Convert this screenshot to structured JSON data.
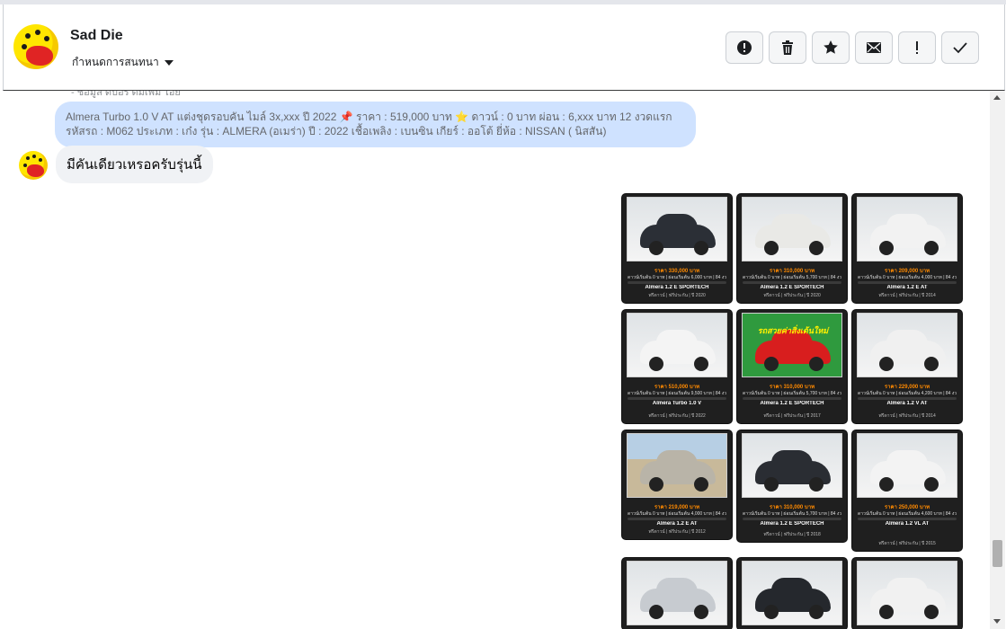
{
  "header": {
    "contact_name": "Sad Die",
    "conversation_menu_label": "กำหนดการสนทนา",
    "actions": [
      {
        "name": "report-button",
        "icon": "exclamation-circle-icon"
      },
      {
        "name": "delete-button",
        "icon": "trash-icon"
      },
      {
        "name": "star-button",
        "icon": "star-icon"
      },
      {
        "name": "mark-unread-button",
        "icon": "envelope-icon"
      },
      {
        "name": "important-button",
        "icon": "exclamation-icon"
      },
      {
        "name": "done-button",
        "icon": "checkmark-icon"
      }
    ]
  },
  "messages": {
    "cut_off_text": "- ชิ้อมูล ดีบอร์ ดิ้มเพิ่ม ไอ้ย",
    "outgoing_text": "Almera Turbo 1.0 V AT แต่งชุดรอบคัน ไมล์ 3x,xxx ปี 2022 📌 ราคา : 519,000 บาท ⭐ ดาวน์ : 0 บาท ผ่อน : 6,xxx บาท 12 งวดแรก รหัสรถ : M062 ประเภท : เก๋ง รุ่น : ALMERA (อเมร่า) ปี : 2022 เชื้อเพลิง : เบนซิน เกียร์ : ออโต้ ยี่ห้อ : NISSAN ( นิสสัน)",
    "incoming_text": "มีคันเดียวเหรอครับรุ่นนี้"
  },
  "cards": [
    {
      "price": "ราคา 330,000 บาท",
      "line": "ดาวน์เริ่มต้น 0 บาท | ผ่อนเริ่มต้น 6,000 บาท | 84 งวด",
      "model": "Almera 1.2 E SPORTECH",
      "meta": "ฟรีดาวน์ | ฟรีประกัน | ปี 2020",
      "photo": "gray",
      "car_color": "#2b2f36"
    },
    {
      "price": "ราคา 310,000 บาท",
      "line": "ดาวน์เริ่มต้น 0 บาท | ผ่อนเริ่มต้น 5,700 บาท | 84 งวด",
      "model": "Almera 1.2 E SPORTECH",
      "meta": "ฟรีดาวน์ | ฟรีประกัน | ปี 2020",
      "photo": "gray",
      "car_color": "#e9e9e6"
    },
    {
      "price": "ราคา 209,000 บาท",
      "line": "ดาวน์เริ่มต้น 0 บาท | ผ่อนเริ่มต้น 4,000 บาท | 84 งวด",
      "model": "Almera 1.2 E AT",
      "meta": "ฟรีดาวน์ | ฟรีประกัน | ปี 2014",
      "photo": "gray",
      "car_color": "#f2f2f2"
    },
    {
      "price": "ราคา 510,000 บาท",
      "line": "ดาวน์เริ่มต้น 0 บาท | ผ่อนเริ่มต้น 9,500 บาท | 84 งวด",
      "model": "Almera Turbo 1.0 V",
      "meta": "ฟรีดาวน์ | ฟรีประกัน | ปี 2022",
      "photo": "gray",
      "car_color": "#f4f4f4"
    },
    {
      "price": "ราคา 310,000 บาท",
      "line": "ดาวน์เริ่มต้น 0 บาท | ผ่อนเริ่มต้น 5,700 บาท | 84 งวด",
      "model": "Almera 1.2 E SPORTECH",
      "meta": "ฟรีดาวน์ | ฟรีประกัน | ปี 2017",
      "photo": "green",
      "car_color": "#d81e1e",
      "banner": "รถสวยค่าสิ่งเด้นใหม่"
    },
    {
      "price": "ราคา 229,000 บาท",
      "line": "ดาวน์เริ่มต้น 0 บาท | ผ่อนเริ่มต้น 4,200 บาท | 84 งวด",
      "model": "Almera 1.2 V AT",
      "meta": "ฟรีดาวน์ | ฟรีประกัน | ปี 2014",
      "photo": "gray",
      "car_color": "#f0f0f0"
    },
    {
      "price": "ราคา 219,000 บาท",
      "line": "ดาวน์เริ่มต้น 0 บาท | ผ่อนเริ่มต้น 4,000 บาท | 84 งวด",
      "model": "Almera 1.2 E AT",
      "meta": "ฟรีดาวน์ | ฟรีประกัน | ปี 2012",
      "photo": "ground",
      "car_color": "#b9b4a8"
    },
    {
      "price": "ราคา 310,000 บาท",
      "line": "ดาวน์เริ่มต้น 0 บาท | ผ่อนเริ่มต้น 5,700 บาท | 84 งวด",
      "model": "Almera 1.2 E SPORTECH",
      "meta": "ฟรีดาวน์ | ฟรีประกัน | ปี 2018",
      "photo": "gray",
      "car_color": "#2a2d33"
    },
    {
      "price": "ราคา 250,000 บาท",
      "line": "ดาวน์เริ่มต้น 0 บาท | ผ่อนเริ่มต้น 4,600 บาท | 84 งวด",
      "model": "Almera 1.2 VL AT",
      "meta": "ฟรีดาวน์ | ฟรีประกัน | ปี 2015",
      "photo": "gray",
      "car_color": "#f3f3f3"
    },
    {
      "price": "",
      "line": "",
      "model": "",
      "meta": "",
      "photo": "gray",
      "car_color": "#c7cbd0"
    },
    {
      "price": "",
      "line": "",
      "model": "",
      "meta": "",
      "photo": "gray",
      "car_color": "#25282d"
    },
    {
      "price": "",
      "line": "",
      "model": "",
      "meta": "",
      "photo": "gray",
      "car_color": "#f1f1f1"
    }
  ]
}
